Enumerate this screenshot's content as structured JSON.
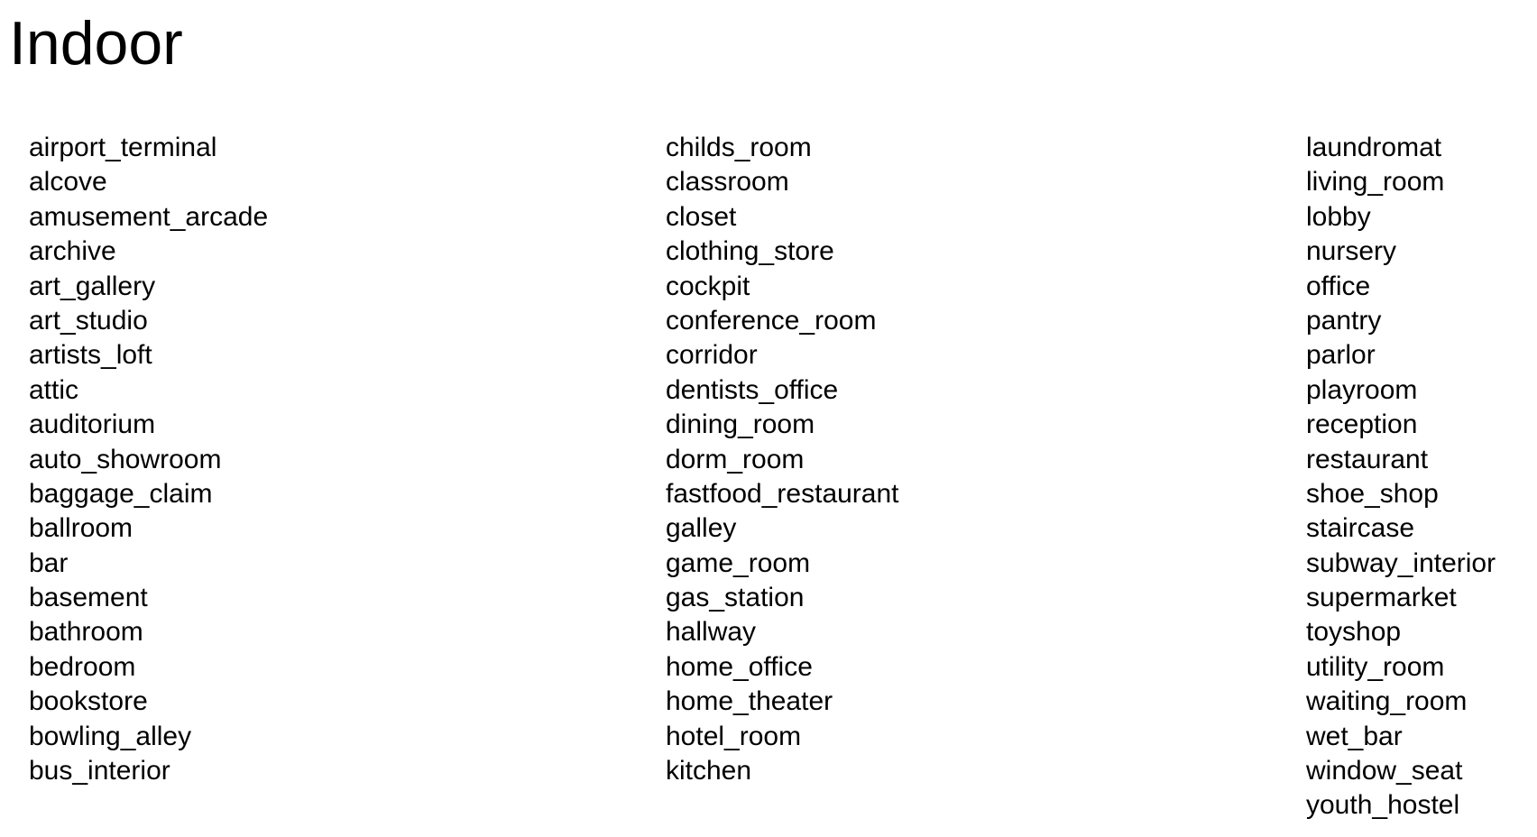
{
  "title": "Indoor",
  "columns": [
    [
      "airport_terminal",
      "alcove",
      "amusement_arcade",
      "archive",
      "art_gallery",
      "art_studio",
      "artists_loft",
      "attic",
      "auditorium",
      "auto_showroom",
      "baggage_claim",
      "ballroom",
      "bar",
      "basement",
      "bathroom",
      "bedroom",
      "bookstore",
      "bowling_alley",
      "bus_interior"
    ],
    [
      "childs_room",
      "classroom",
      "closet",
      "clothing_store",
      "cockpit",
      "conference_room",
      "corridor",
      "dentists_office",
      "dining_room",
      "dorm_room",
      "fastfood_restaurant",
      "galley",
      "game_room",
      "gas_station",
      "hallway",
      "home_office",
      "home_theater",
      "hotel_room",
      "kitchen"
    ],
    [
      "laundromat",
      "living_room",
      "lobby",
      "nursery",
      "office",
      "pantry",
      "parlor",
      "playroom",
      "reception",
      "restaurant",
      "shoe_shop",
      "staircase",
      "subway_interior",
      "supermarket",
      "toyshop",
      "utility_room",
      "waiting_room",
      "wet_bar",
      "window_seat",
      "youth_hostel"
    ]
  ]
}
